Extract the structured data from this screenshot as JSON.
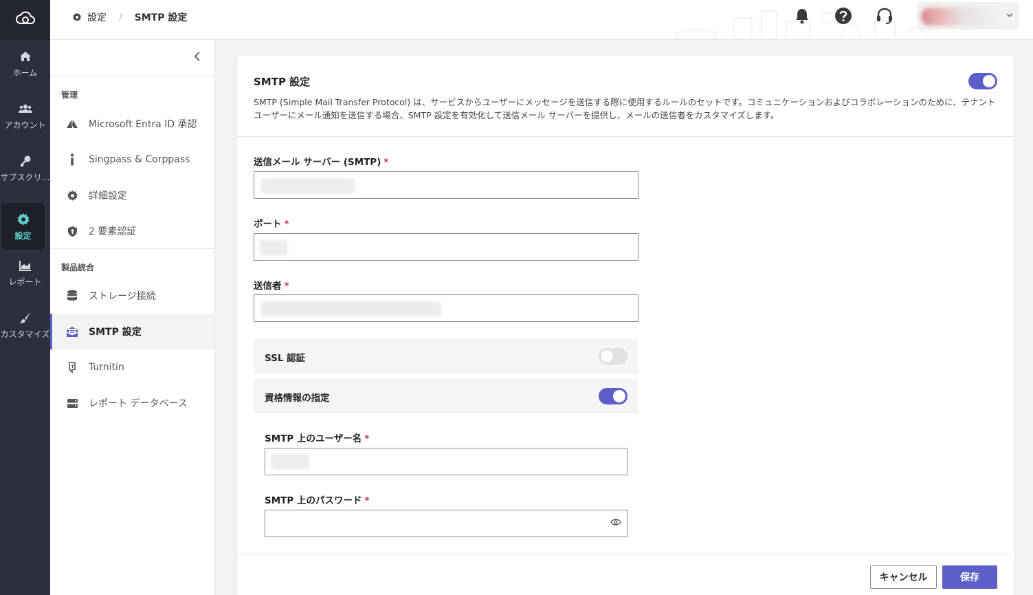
{
  "rail": {
    "items": [
      {
        "label": "ホーム",
        "icon": "home-icon"
      },
      {
        "label": "アカウント",
        "icon": "accounts-icon"
      },
      {
        "label": "サブスクリ…",
        "icon": "key-icon"
      },
      {
        "label": "設定",
        "icon": "gear-icon",
        "active": true
      },
      {
        "label": "レポート",
        "icon": "chart-icon"
      },
      {
        "label": "カスタマイズ",
        "icon": "brush-icon"
      }
    ]
  },
  "breadcrumb": {
    "root": "設定",
    "current": "SMTP 設定"
  },
  "sidebar": {
    "section_admin": "管理",
    "admin_items": [
      {
        "label": "Microsoft Entra ID 承認",
        "icon": "entra-icon"
      },
      {
        "label": "Singpass & Corppass",
        "icon": "info-icon"
      },
      {
        "label": "詳細設定",
        "icon": "gear-icon"
      },
      {
        "label": "2 要素認証",
        "icon": "shield-icon"
      }
    ],
    "section_integration": "製品統合",
    "integration_items": [
      {
        "label": "ストレージ接続",
        "icon": "database-icon"
      },
      {
        "label": "SMTP 設定",
        "icon": "mail-icon",
        "active": true
      },
      {
        "label": "Turnitin",
        "icon": "turnitin-icon"
      },
      {
        "label": "レポート データベース",
        "icon": "server-icon"
      }
    ]
  },
  "card": {
    "title": "SMTP 設定",
    "enabled": true,
    "description": "SMTP (Simple Mail Transfer Protocol) は、サービスからユーザーにメッセージを送信する際に使用するルールのセットです。コミュニケーションおよびコラボレーションのために、テナント ユーザーにメール通知を送信する場合、SMTP 設定を有効化して送信メール サーバーを提供し、メールの送信者をカスタマイズします。"
  },
  "form": {
    "server_label": "送信メール サーバー (SMTP)",
    "port_label": "ポート",
    "sender_label": "送信者",
    "required_mark": "*",
    "ssl_label": "SSL 認証",
    "ssl_enabled": false,
    "credentials_label": "資格情報の指定",
    "credentials_enabled": true,
    "username_label": "SMTP 上のユーザー名",
    "password_label": "SMTP 上のパスワード"
  },
  "actions": {
    "cancel": "キャンセル",
    "save": "保存"
  },
  "colors": {
    "accent": "#5b5fc7",
    "rail_bg": "#2c2f3d",
    "rail_active_text": "#5ed3c9",
    "required": "#c4314b"
  }
}
